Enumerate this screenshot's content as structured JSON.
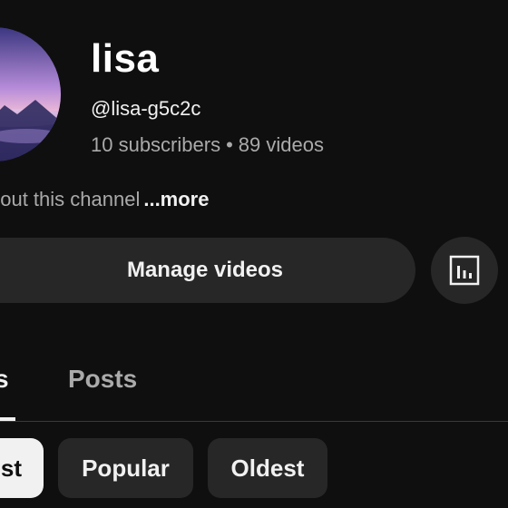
{
  "channel": {
    "name": "lisa",
    "handle": "@lisa-g5c2c",
    "subscribers": "10 subscribers",
    "separator": "•",
    "videos": "89 videos",
    "about_text": "bout this channel",
    "more_label": "...more"
  },
  "actions": {
    "manage_videos_label": "Manage videos",
    "analytics_icon": "analytics-bar-chart-icon"
  },
  "tabs": [
    {
      "label": "s",
      "selected": true
    },
    {
      "label": "Posts",
      "selected": false
    }
  ],
  "chips": [
    {
      "label": "st",
      "selected": true
    },
    {
      "label": "Popular",
      "selected": false
    },
    {
      "label": "Oldest",
      "selected": false
    }
  ],
  "colors": {
    "background": "#0f0f0f",
    "surface": "#272727",
    "text_primary": "#f1f1f1",
    "text_secondary": "#aaaaaa",
    "chip_selected_bg": "#f1f1f1"
  }
}
